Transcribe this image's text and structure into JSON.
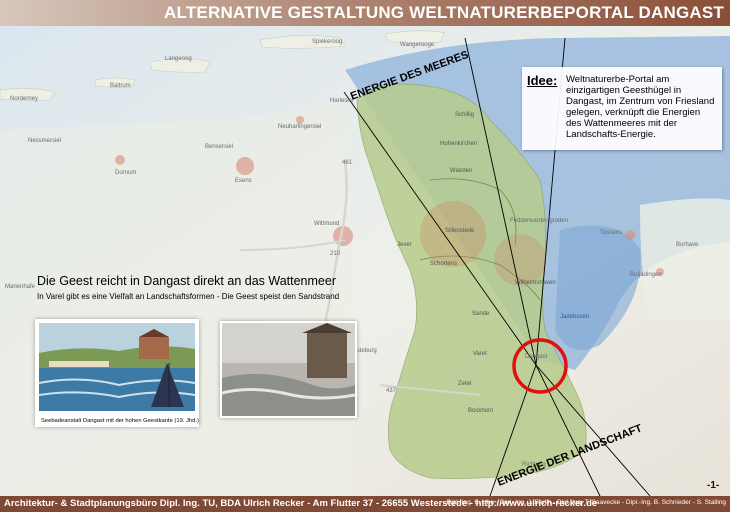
{
  "header": {
    "title": "ALTERNATIVE GESTALTUNG WELTNATURERBEPORTAL DANGAST"
  },
  "idea": {
    "label": "Idee:",
    "text": "Weltnaturerbe-Portal am einzigartigen Geesthügel in Dangast, im Zentrum von Friesland gelegen, verknüpft die Energien des Wattenmeeres mit der Landschafts-Energie."
  },
  "geest": {
    "title": "Die Geest  reicht in Dangast direkt an das Wattenmeer",
    "subtitle": "In Varel gibt es eine Vielfalt an Landschaftsformen - Die Geest speist den Sandstrand"
  },
  "photos": {
    "left_caption": "Seebadeanstalt Dangast mit der hohen Geestkante (19. Jhd.)",
    "right_caption": ""
  },
  "annotations": {
    "sea_energy": "ENERGIE DES MEERES",
    "land_energy": "ENERGIE DER LANDSCHAFT"
  },
  "map": {
    "highlight_place": "Dangast",
    "places": {
      "spiekeroog": "Spiekeroog",
      "wangerooge": "Wangerooge",
      "langeoog": "Langeoog",
      "baltrum": "Baltrum",
      "norderney": "Norderney",
      "nessmersiel": "Nessmersiel",
      "bensersiel": "Bensersiel",
      "neuharlingersiel": "Neuharlingersiel",
      "harlesiel": "Harlesiel",
      "dornum": "Dornum",
      "esens": "Esens",
      "wittmund": "Wittmund",
      "schillig": "Schillig",
      "hohenkirchen": "Hohenkirchen",
      "wiarden": "Wiarden",
      "jever": "Jever",
      "sillenstede": "Sillenstede",
      "schortens": "Schortens",
      "wilhelmshaven": "Wilhelmshaven",
      "sande": "Sande",
      "varel": "Varel",
      "zetel": "Zetel",
      "bockhorn": "Bockhorn",
      "fedderwardergroden": "Fedderwarder-groden",
      "tossens": "Tossens",
      "butjadingen": "Butjadingen",
      "burhave": "Burhave",
      "jadebusen": "Jadebusen",
      "richtung": "Richtung",
      "aurich": "Marienhafe",
      "friedeburg": "deburg"
    },
    "road_labels": {
      "r1": "461",
      "r2": "210",
      "r3": "437"
    }
  },
  "footer": {
    "left": "Architektur- & Stadtplanungsbüro Dipl. Ing. TU, BDA Ulrich Recker - Am Flutter 37 - 26655 Westerstede - http://www.ulrich-recker.de",
    "right": "Dipl.-Ing. K. Uhe - Dipl.-Ing. J. Berlin - Dipl.-Ing. T. Saavecke - Dipl.-Ing. B. Schnieder - S. Stalling",
    "page": "-1-"
  },
  "colors": {
    "title_bar": "#8a4e37",
    "footer_bar": "#7e4a36",
    "sea_zone": "#8fb3dc",
    "land_zone": "#b7cc8c",
    "highlight_ring": "#e01010"
  }
}
